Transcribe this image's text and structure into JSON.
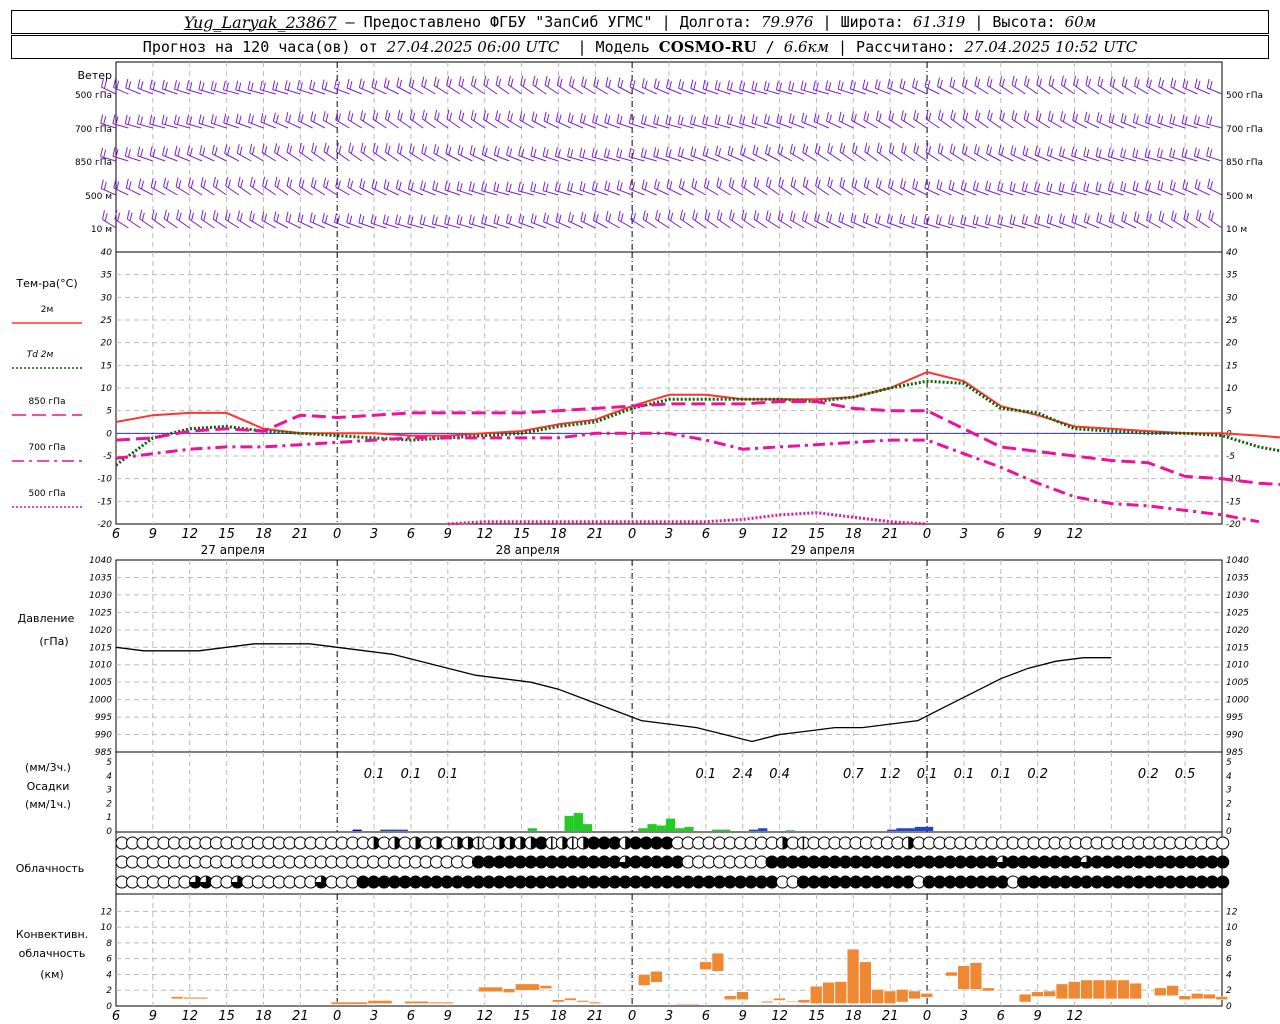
{
  "header": {
    "station": "Yug_Laryak_23867",
    "provider": "– Предоставлено ФГБУ \"ЗапСиб УГМС\"",
    "lon_label": "Долгота:",
    "lon": "79.976",
    "lat_label": "Широта:",
    "lat": "61.319",
    "alt_label": "Высота:",
    "alt": "60м",
    "forecast_label": "Прогноз на 120 часа(ов) от",
    "forecast_start": "27.04.2025 06:00 UTC",
    "model_label": "Модель",
    "model": "COSMO-RU",
    "resolution": "6.6км",
    "computed_label": "Рассчитано:",
    "computed": "27.04.2025 10:52 UTC"
  },
  "chart_data": [
    {
      "type": "wind-barbs",
      "label": "Ветер",
      "levels": [
        "500 гПа",
        "700 гПа",
        "850 гПа",
        "500 м",
        "10 м"
      ]
    },
    {
      "type": "line",
      "label": "Тем-ра(°C)",
      "ylim": [
        -20,
        40
      ],
      "yticks": [
        -20,
        -15,
        -10,
        -5,
        0,
        5,
        10,
        15,
        20,
        25,
        30,
        35,
        40
      ],
      "x_hours": [
        0,
        3,
        6,
        9,
        12,
        15,
        18,
        21,
        24,
        27,
        30,
        33,
        36,
        39,
        42,
        45,
        48,
        51,
        54,
        57,
        60,
        63,
        66,
        69,
        72,
        75,
        78,
        81,
        84,
        87,
        90,
        93,
        96,
        99,
        102,
        105,
        108,
        111,
        114,
        117,
        120
      ],
      "series": [
        {
          "name": "2м",
          "color": "#ff3333",
          "style": "solid",
          "values": [
            2.5,
            4,
            4.5,
            4.5,
            1,
            0,
            0,
            0,
            -0.5,
            -0.5,
            0,
            0.5,
            2,
            3,
            6,
            8.5,
            8.5,
            7.5,
            7.5,
            7.5,
            8,
            10,
            13.5,
            11.5,
            6,
            4,
            1.5,
            1,
            0.5,
            0,
            0,
            -0.5,
            -1.2,
            1,
            1,
            2,
            1.5
          ]
        },
        {
          "name": "Td 2м",
          "color": "#006600",
          "style": "dots",
          "values": [
            -7,
            -1,
            1,
            1.5,
            0.5,
            0,
            -0.5,
            -1,
            -1.5,
            -1,
            -0.5,
            0,
            1.5,
            2.5,
            5.5,
            7.5,
            7.5,
            7.5,
            7.5,
            7,
            8,
            10,
            11.5,
            11,
            5.5,
            4.5,
            1,
            0.5,
            0,
            0,
            -0.5,
            -3,
            -4.5,
            -4.5,
            -5,
            -3.5,
            -1.5,
            -1
          ]
        },
        {
          "name": "850 гПа",
          "color": "#ee1199",
          "style": "long-dash",
          "values": [
            -1.5,
            -1,
            0.5,
            1,
            0.5,
            4,
            3.5,
            4,
            4.5,
            4.5,
            4.5,
            4.5,
            5,
            5.5,
            6,
            6.5,
            6.5,
            6.5,
            7,
            7,
            5.5,
            5,
            5,
            1,
            -3,
            -4,
            -5,
            -6,
            -6.5,
            -9.5,
            -10,
            -11,
            -11.5,
            -11,
            -9,
            -7
          ]
        },
        {
          "name": "700 гПа",
          "color": "#ee1199",
          "style": "dash-dot",
          "values": [
            -5.5,
            -4.5,
            -3.5,
            -3,
            -3,
            -2.5,
            -2,
            -1.5,
            -1,
            -1,
            -1,
            -1,
            -1,
            0,
            0,
            0,
            -1.5,
            -3.5,
            -3,
            -2.5,
            -2,
            -1.5,
            -1.5,
            -4.5,
            -7.5,
            -11,
            -14,
            -15.5,
            -16,
            -17,
            -18,
            -19.5,
            null,
            -21,
            -20,
            -18.5,
            -16.5,
            -14
          ]
        },
        {
          "name": "500 гПа",
          "color": "#ee1199",
          "style": "dense-dots",
          "values": [
            null,
            null,
            null,
            null,
            null,
            null,
            null,
            null,
            null,
            -20,
            -19.5,
            -19.5,
            -19.5,
            -19.5,
            -19.5,
            -19.5,
            -19.5,
            -19,
            -18,
            -17.5,
            -18.5,
            -19.5,
            -20
          ]
        }
      ]
    },
    {
      "type": "line",
      "label": "Давление",
      "unit": "(гПа)",
      "ylim": [
        985,
        1040
      ],
      "yticks": [
        985,
        990,
        995,
        1000,
        1005,
        1010,
        1015,
        1020,
        1025,
        1030,
        1035,
        1040
      ],
      "x_hours": [
        0,
        3,
        6,
        9,
        12,
        15,
        18,
        21,
        24,
        27,
        30,
        33,
        36,
        39,
        42,
        45,
        48,
        51,
        54,
        57,
        60,
        63,
        66,
        69,
        72,
        75,
        78,
        81,
        84,
        87,
        90,
        93,
        96,
        99,
        102,
        105,
        108,
        111,
        114,
        117,
        120
      ],
      "series": [
        {
          "name": "",
          "color": "#000000",
          "values": [
            1015,
            1014,
            1014,
            1014,
            1015,
            1016,
            1016,
            1016,
            1015,
            1014,
            1013,
            1011,
            1009,
            1007,
            1006,
            1005,
            1003,
            1000,
            997,
            994,
            993,
            992,
            990,
            988,
            990,
            991,
            992,
            992,
            993,
            994,
            998,
            1002,
            1006,
            1009,
            1011,
            1012,
            1012
          ]
        }
      ]
    },
    {
      "type": "bar",
      "label": "Осадки",
      "unit_3h": "(мм/3ч.)",
      "unit_1h": "(мм/1ч.)",
      "ylim": [
        0,
        5
      ],
      "yticks": [
        0,
        1,
        2,
        3,
        4,
        5
      ],
      "three_hour_labels": [
        {
          "hour": 21,
          "text": "0.1"
        },
        {
          "hour": 24,
          "text": "0.1"
        },
        {
          "hour": 27,
          "text": "0.1"
        },
        {
          "hour": 48,
          "text": "0.1"
        },
        {
          "hour": 51,
          "text": "2.4"
        },
        {
          "hour": 54,
          "text": "0.4"
        },
        {
          "hour": 60,
          "text": "0.7"
        },
        {
          "hour": 63,
          "text": "1.2"
        },
        {
          "hour": 66,
          "text": "0.1"
        },
        {
          "hour": 69,
          "text": "0.1"
        },
        {
          "hour": 72,
          "text": "0.1"
        },
        {
          "hour": 75,
          "text": "0.2"
        },
        {
          "hour": 84,
          "text": "0.2"
        },
        {
          "hour": 87,
          "text": "0.5"
        }
      ],
      "bars": [
        {
          "hour": 17,
          "value": 0.1,
          "color": "#0000cc"
        },
        {
          "hour": 20,
          "value": 0.1,
          "color": "#2244cc"
        },
        {
          "hour": 21,
          "value": 0.1,
          "color": "#2244cc"
        },
        {
          "hour": 22,
          "value": 0.1,
          "color": "#2244cc"
        },
        {
          "hour": 36,
          "value": 0.2,
          "color": "#22cc22"
        },
        {
          "hour": 40,
          "value": 1.1,
          "color": "#22cc22"
        },
        {
          "hour": 41,
          "value": 1.3,
          "color": "#22cc22"
        },
        {
          "hour": 42,
          "value": 0.5,
          "color": "#22cc22"
        },
        {
          "hour": 48,
          "value": 0.2,
          "color": "#22cc22"
        },
        {
          "hour": 49,
          "value": 0.5,
          "color": "#22cc22"
        },
        {
          "hour": 50,
          "value": 0.4,
          "color": "#22cc22"
        },
        {
          "hour": 51,
          "value": 0.9,
          "color": "#22cc22"
        },
        {
          "hour": 52,
          "value": 0.2,
          "color": "#22cc22"
        },
        {
          "hour": 53,
          "value": 0.3,
          "color": "#22cc22"
        },
        {
          "hour": 56,
          "value": 0.1,
          "color": "#22cc22"
        },
        {
          "hour": 57,
          "value": 0.1,
          "color": "#22cc22"
        },
        {
          "hour": 60,
          "value": 0.1,
          "color": "#2244cc"
        },
        {
          "hour": 61,
          "value": 0.2,
          "color": "#2244cc"
        },
        {
          "hour": 64,
          "value": 0.05,
          "color": "#22cc22"
        },
        {
          "hour": 75,
          "value": 0.1,
          "color": "#2244cc"
        },
        {
          "hour": 76,
          "value": 0.2,
          "color": "#2244cc"
        },
        {
          "hour": 77,
          "value": 0.2,
          "color": "#2244cc"
        },
        {
          "hour": 78,
          "value": 0.3,
          "color": "#2244cc"
        },
        {
          "hour": 79,
          "value": 0.3,
          "color": "#2244cc"
        }
      ]
    },
    {
      "type": "cloud-symbols",
      "label": "Облачность",
      "rows": [
        "0000000000000000000000002020202022102222412124442444400000000002010000000002000000000000000000000000000000",
        "0000000000000000000000000000000000444444444444443444440000000044444444444444444444443444444434444444444444",
        "0000000330030000000300044444444444444444444444444444444444444440044444444444044444444044444444444444444444"
      ]
    },
    {
      "type": "bar",
      "label": "Конвективн. облачность",
      "unit": "(км)",
      "ylim": [
        0,
        13
      ],
      "yticks": [
        0,
        2,
        4,
        6,
        8,
        10,
        12
      ],
      "segments": [
        {
          "x0": 4.5,
          "x1": 5.5,
          "bottom": 0.9,
          "top": 1.2
        },
        {
          "x0": 5.5,
          "x1": 7.5,
          "bottom": 0.9,
          "top": 1.1
        },
        {
          "x0": 17.5,
          "x1": 20.5,
          "bottom": 0.2,
          "top": 0.5
        },
        {
          "x0": 20.5,
          "x1": 22.5,
          "bottom": 0.3,
          "top": 0.7
        },
        {
          "x0": 23.5,
          "x1": 25.5,
          "bottom": 0.3,
          "top": 0.6
        },
        {
          "x0": 25.5,
          "x1": 27.5,
          "bottom": 0.3,
          "top": 0.5
        },
        {
          "x0": 29.5,
          "x1": 31.5,
          "bottom": 1.8,
          "top": 2.4
        },
        {
          "x0": 31.5,
          "x1": 32.5,
          "bottom": 1.7,
          "top": 2.2
        },
        {
          "x0": 32.5,
          "x1": 34.5,
          "bottom": 2.0,
          "top": 2.8
        },
        {
          "x0": 34.5,
          "x1": 35.5,
          "bottom": 2.2,
          "top": 2.6
        },
        {
          "x0": 35.5,
          "x1": 36.5,
          "bottom": 0.5,
          "top": 0.8
        },
        {
          "x0": 36.5,
          "x1": 37.5,
          "bottom": 0.7,
          "top": 1.0
        },
        {
          "x0": 37.5,
          "x1": 38.5,
          "bottom": 0.5,
          "top": 0.7
        },
        {
          "x0": 38.5,
          "x1": 39.5,
          "bottom": 0.3,
          "top": 0.5
        },
        {
          "x0": 42.5,
          "x1": 43.5,
          "bottom": 2.6,
          "top": 4.0
        },
        {
          "x0": 43.5,
          "x1": 44.5,
          "bottom": 3.0,
          "top": 4.4
        },
        {
          "x0": 45.5,
          "x1": 47.5,
          "bottom": 0.2,
          "top": 0.3
        },
        {
          "x0": 47.5,
          "x1": 48.5,
          "bottom": 4.6,
          "top": 5.6
        },
        {
          "x0": 48.5,
          "x1": 49.5,
          "bottom": 4.4,
          "top": 6.7
        },
        {
          "x0": 49.5,
          "x1": 50.5,
          "bottom": 0.8,
          "top": 1.3
        },
        {
          "x0": 50.5,
          "x1": 51.5,
          "bottom": 0.8,
          "top": 1.8
        },
        {
          "x0": 52.5,
          "x1": 53.5,
          "bottom": 0.4,
          "top": 0.6
        },
        {
          "x0": 53.5,
          "x1": 54.5,
          "bottom": 0.7,
          "top": 1.0
        },
        {
          "x0": 54.5,
          "x1": 55.5,
          "bottom": 0.5,
          "top": 0.6
        },
        {
          "x0": 55.5,
          "x1": 56.5,
          "bottom": 0.4,
          "top": 0.8
        },
        {
          "x0": 56.5,
          "x1": 57.5,
          "bottom": 0.3,
          "top": 2.5
        },
        {
          "x0": 57.5,
          "x1": 58.5,
          "bottom": 0.3,
          "top": 3.0
        },
        {
          "x0": 58.5,
          "x1": 59.5,
          "bottom": 0.3,
          "top": 3.1
        },
        {
          "x0": 59.5,
          "x1": 60.5,
          "bottom": 0.3,
          "top": 7.2
        },
        {
          "x0": 60.5,
          "x1": 61.5,
          "bottom": 0.3,
          "top": 5.6
        },
        {
          "x0": 61.5,
          "x1": 62.5,
          "bottom": 0.3,
          "top": 2.1
        },
        {
          "x0": 62.5,
          "x1": 63.5,
          "bottom": 0.3,
          "top": 1.9
        },
        {
          "x0": 63.5,
          "x1": 64.5,
          "bottom": 0.5,
          "top": 2.1
        },
        {
          "x0": 64.5,
          "x1": 65.5,
          "bottom": 0.9,
          "top": 1.9
        },
        {
          "x0": 65.5,
          "x1": 66.5,
          "bottom": 1.1,
          "top": 1.6
        },
        {
          "x0": 67.5,
          "x1": 68.5,
          "bottom": 3.8,
          "top": 4.3
        },
        {
          "x0": 68.5,
          "x1": 69.5,
          "bottom": 2.1,
          "top": 5.1
        },
        {
          "x0": 69.5,
          "x1": 70.5,
          "bottom": 2.1,
          "top": 5.5
        },
        {
          "x0": 70.5,
          "x1": 71.5,
          "bottom": 1.9,
          "top": 2.3
        },
        {
          "x0": 73.5,
          "x1": 74.5,
          "bottom": 0.5,
          "top": 1.5
        },
        {
          "x0": 74.5,
          "x1": 75.5,
          "bottom": 1.2,
          "top": 1.8
        },
        {
          "x0": 75.5,
          "x1": 76.5,
          "bottom": 1.2,
          "top": 1.9
        },
        {
          "x0": 76.5,
          "x1": 77.5,
          "bottom": 0.9,
          "top": 2.8
        },
        {
          "x0": 77.5,
          "x1": 78.5,
          "bottom": 0.9,
          "top": 3.1
        },
        {
          "x0": 78.5,
          "x1": 79.5,
          "bottom": 0.9,
          "top": 3.3
        },
        {
          "x0": 79.5,
          "x1": 80.5,
          "bottom": 0.9,
          "top": 3.3
        },
        {
          "x0": 80.5,
          "x1": 81.5,
          "bottom": 0.9,
          "top": 3.3
        },
        {
          "x0": 81.5,
          "x1": 82.5,
          "bottom": 0.9,
          "top": 3.3
        },
        {
          "x0": 82.5,
          "x1": 83.5,
          "bottom": 0.9,
          "top": 2.9
        },
        {
          "x0": 84.5,
          "x1": 85.5,
          "bottom": 1.3,
          "top": 2.3
        },
        {
          "x0": 85.5,
          "x1": 86.5,
          "bottom": 1.3,
          "top": 2.6
        },
        {
          "x0": 86.5,
          "x1": 87.5,
          "bottom": 0.8,
          "top": 1.3
        },
        {
          "x0": 87.5,
          "x1": 88.5,
          "bottom": 0.9,
          "top": 1.6
        },
        {
          "x0": 88.5,
          "x1": 89.5,
          "bottom": 0.9,
          "top": 1.5
        },
        {
          "x0": 89.5,
          "x1": 90.5,
          "bottom": 0.8,
          "top": 1.2
        }
      ]
    }
  ],
  "x_axis": {
    "hour_ticks": [
      "6",
      "9",
      "12",
      "15",
      "18",
      "21",
      "0",
      "3",
      "6",
      "9",
      "12",
      "15",
      "18",
      "21",
      "0",
      "3",
      "6",
      "9",
      "12",
      "15",
      "18",
      "21",
      "0",
      "3",
      "6",
      "9",
      "12"
    ],
    "date_labels": [
      {
        "hour": 9,
        "text": "27 апреля"
      },
      {
        "hour": 33,
        "text": "28 апреля"
      },
      {
        "hour": 57,
        "text": "29 апреля"
      }
    ],
    "midnights": [
      18,
      42,
      66
    ]
  }
}
